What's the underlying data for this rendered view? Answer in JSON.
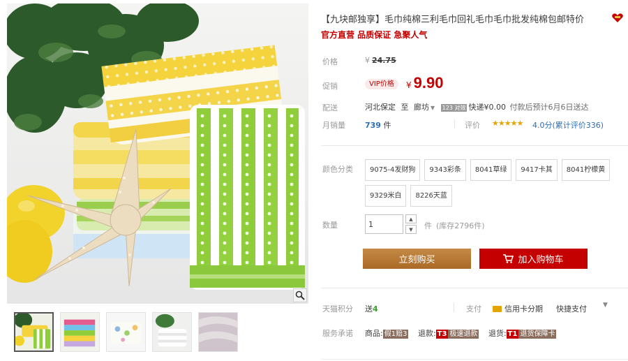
{
  "product": {
    "title": "【九块邮独享】毛巾纯棉三利毛巾回礼毛巾毛巾批发纯棉包邮特价",
    "subtitle": "官方直营 品质保证 急聚人气"
  },
  "labels": {
    "price": "价格",
    "promo": "促销",
    "delivery": "配送",
    "monthly_sales": "月销量",
    "rating": "评价",
    "color": "颜色分类",
    "quantity": "数量",
    "points": "天猫积分",
    "payment": "支付",
    "service": "服务承诺"
  },
  "price": {
    "currency": "¥",
    "original": "24.75",
    "vip_label": "VIP价格",
    "promo_currency": "¥",
    "promo": "9.90"
  },
  "delivery": {
    "from": "河北保定",
    "to_word": "至",
    "to": "廊坊",
    "caret": "▼",
    "tag": "123 对效",
    "fee": "快递¥0.00",
    "eta": "付款后预计6月6日送达"
  },
  "sales": {
    "count": "739",
    "unit": "件",
    "stars": "★★★★★",
    "score": "4.0分",
    "reviews": "(累计评价336)"
  },
  "skus": [
    "9075-4发财狗",
    "9343彩条",
    "8041草绿",
    "9417卡其",
    "8041柠檬黄",
    "9329米白",
    "8226天蓝"
  ],
  "quantity": {
    "value": "1",
    "up": "▲",
    "down": "▼",
    "unit": "件",
    "stock": "(库存2796件)"
  },
  "buttons": {
    "buy_now": "立刻购买",
    "add_to_cart": "加入购物车"
  },
  "points": {
    "prefix": "送",
    "value": "4"
  },
  "payment": {
    "credit_installment": "信用卡分期",
    "quick_pay": "快捷支付",
    "more": "▼"
  },
  "service": {
    "item1_label": "商品:",
    "item1_tag": "假1赔3",
    "item2_label": "退款:",
    "item2_tag_num": "T3",
    "item2_tag": "极速退款",
    "item3_label": "退货:",
    "item3_tag_num": "T1",
    "item3_tag": "退货保障卡"
  },
  "colors": {
    "accent_red": "#c40000",
    "buy_brown": "#b5752f",
    "link_blue": "#2c6fb5",
    "points_green": "#39a12c",
    "star_gold": "#e5a400"
  },
  "icons": [
    "magnifier-icon",
    "cart-icon",
    "credit-card-icon",
    "tmall-badge-icon"
  ]
}
